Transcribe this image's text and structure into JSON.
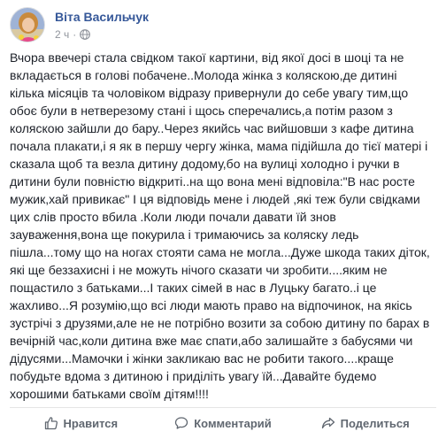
{
  "post": {
    "author": "Віта Васильчук",
    "time": "2 ч",
    "privacy_icon": "globe-icon",
    "body_lines": [
      "Вчора ввечері стала свідком такої картини, від якої досі в шоці та не",
      "вкладається в голові побачене..Молода жінка з коляскою,де дитині",
      "кілька місяців та чоловіком відразу привернули до себе увагу тим,що",
      "обоє були в нетверезому стані і щось сперечались,а потім разом з",
      "коляскою зайшли до бару..Через якийсь час вийшовши з кафе дитина",
      "почала плакати,і я як в першу чергу жінка, мама підійшла до тієї матері і",
      "сказала щоб та везла дитину додому,бо на вулиці холодно і ручки в",
      "дитини були повністю відкриті..на що вона мені відповіла:\"В нас росте",
      "мужик,хай привикає\" І ця відповідь мене і людей ,які теж були свідками",
      "цих слів просто вбила .Коли люди почали давати їй знов",
      "зауваження,вона ще покурила і тримаючись за коляску ледь",
      "пішла...тому що на ногах стояти сама не могла...Дуже шкода таких діток,",
      "які ще беззахисні і не можуть нічого сказати чи зробити....яким не",
      "пощастило з батьками...І таких сімей в нас в Луцьку багато..і це",
      "жахливо...Я розумію,що всі люди мають право на відпочинок, на якісь",
      "зустрічі з друзями,але не не потрібно возити за собою дитину по барах в",
      "вечірній час,коли дитина вже має спати,або залишайте з бабусями чи",
      "дідусями...Мамочки і жінки закликаю вас не робити такого....краще",
      "побудьте вдома з дитиною і приділіть увагу їй...Давайте будемо",
      "хорошими батьками своїм дітям!!!!"
    ]
  },
  "actions": {
    "like": {
      "label": "Нравится",
      "icon": "thumbs-up-icon"
    },
    "comment": {
      "label": "Комментарий",
      "icon": "comment-icon"
    },
    "share": {
      "label": "Поделиться",
      "icon": "share-icon"
    }
  },
  "colors": {
    "author_link": "#365899",
    "meta_text": "#90949c",
    "body_text": "#1d2129",
    "action_text": "#606770"
  }
}
